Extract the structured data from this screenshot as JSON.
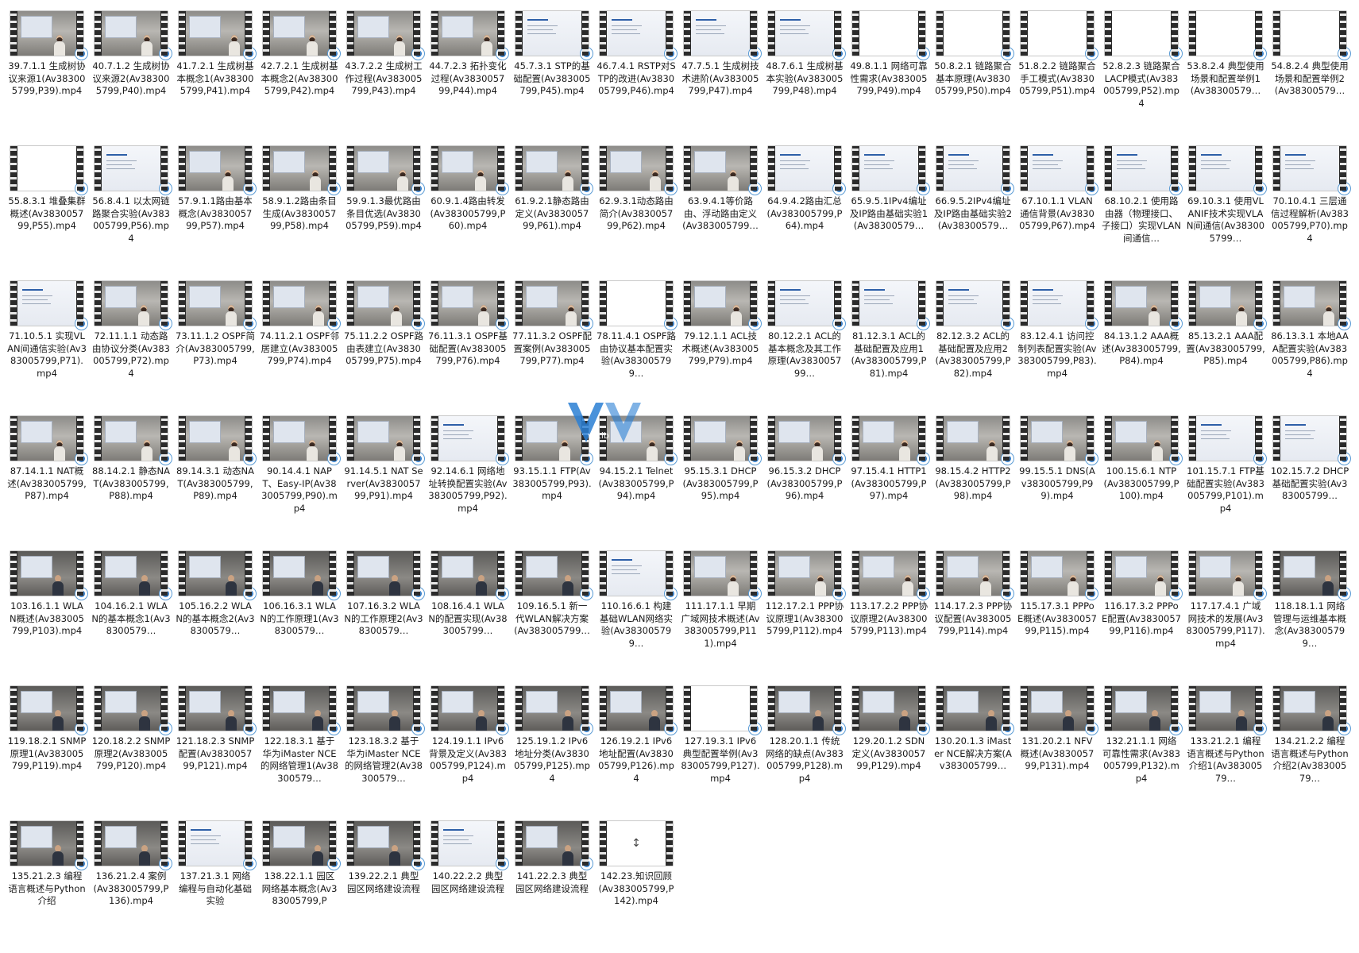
{
  "files": [
    {
      "label": "39.7.1.1 生成树协议来源1(Av383005799,P39).mp4",
      "thumb": "person"
    },
    {
      "label": "40.7.1.2 生成树协议来源2(Av383005799,P40).mp4",
      "thumb": "person"
    },
    {
      "label": "41.7.2.1 生成树基本概念1(Av383005799,P41).mp4",
      "thumb": "person"
    },
    {
      "label": "42.7.2.1 生成树基本概念2(Av383005799,P42).mp4",
      "thumb": "person"
    },
    {
      "label": "43.7.2.2 生成树工作过程(Av383005799,P43).mp4",
      "thumb": "person"
    },
    {
      "label": "44.7.2.3 拓扑变化过程(Av383005799,P44).mp4",
      "thumb": "person"
    },
    {
      "label": "45.7.3.1 STP的基础配置(Av383005799,P45).mp4",
      "thumb": "slide"
    },
    {
      "label": "46.7.4.1 RSTP对STP的改进(Av383005799,P46).mp4",
      "thumb": "slide"
    },
    {
      "label": "47.7.5.1 生成树技术进阶(Av383005799,P47).mp4",
      "thumb": "slide"
    },
    {
      "label": "48.7.6.1 生成树基本实验(Av383005799,P48).mp4",
      "thumb": "slide"
    },
    {
      "label": "49.8.1.1 网络可靠性需求(Av383005799,P49).mp4",
      "thumb": "blank"
    },
    {
      "label": "50.8.2.1 链路聚合基本原理(Av383005799,P50).mp4",
      "thumb": "blank"
    },
    {
      "label": "51.8.2.2 链路聚合手工模式(Av383005799,P51).mp4",
      "thumb": "blank"
    },
    {
      "label": "52.8.2.3 链路聚合LACP模式(Av383005799,P52).mp4",
      "thumb": "blank"
    },
    {
      "label": "53.8.2.4 典型使用场景和配置举例1(Av38300579…",
      "thumb": "blank"
    },
    {
      "label": "54.8.2.4 典型使用场景和配置举例2(Av38300579…",
      "thumb": "blank"
    },
    {
      "label": "55.8.3.1 堆叠集群概述(Av383005799,P55).mp4",
      "thumb": "blank"
    },
    {
      "label": "56.8.4.1 以太网链路聚合实验(Av383005799,P56).mp4",
      "thumb": "slide"
    },
    {
      "label": "57.9.1.1路由基本概念(Av383005799,P57).mp4",
      "thumb": "person"
    },
    {
      "label": "58.9.1.2路由条目生成(Av383005799,P58).mp4",
      "thumb": "person"
    },
    {
      "label": "59.9.1.3最优路由条目优选(Av383005799,P59).mp4",
      "thumb": "person"
    },
    {
      "label": "60.9.1.4路由转发(Av383005799,P60).mp4",
      "thumb": "person"
    },
    {
      "label": "61.9.2.1静态路由定义(Av383005799,P61).mp4",
      "thumb": "person"
    },
    {
      "label": "62.9.3.1动态路由简介(Av383005799,P62).mp4",
      "thumb": "person"
    },
    {
      "label": "63.9.4.1等价路由、浮动路由定义(Av383005799…",
      "thumb": "person"
    },
    {
      "label": "64.9.4.2路由汇总(Av383005799,P64).mp4",
      "thumb": "slide"
    },
    {
      "label": "65.9.5.1IPv4编址及IP路由基础实验1(Av38300579…",
      "thumb": "slide"
    },
    {
      "label": "66.9.5.2IPv4编址及IP路由基础实验2(Av38300579…",
      "thumb": "slide"
    },
    {
      "label": "67.10.1.1 VLAN通信背景(Av383005799,P67).mp4",
      "thumb": "slide"
    },
    {
      "label": "68.10.2.1 使用路由器（物理接口、子接口）实现VLAN间通信…",
      "thumb": "slide"
    },
    {
      "label": "69.10.3.1 使用VLANIF技术实现VLAN间通信(Av383005799…",
      "thumb": "slide"
    },
    {
      "label": "70.10.4.1 三层通信过程解析(Av383005799,P70).mp4",
      "thumb": "slide"
    },
    {
      "label": "71.10.5.1 实现VLAN间通信实验(Av383005799,P71).mp4",
      "thumb": "slide"
    },
    {
      "label": "72.11.1.1 动态路由协议分类(Av383005799,P72).mp4",
      "thumb": "person"
    },
    {
      "label": "73.11.1.2 OSPF简介(Av383005799,P73).mp4",
      "thumb": "person"
    },
    {
      "label": "74.11.2.1 OSPF邻居建立(Av383005799,P74).mp4",
      "thumb": "person"
    },
    {
      "label": "75.11.2.2 OSPF路由表建立(Av383005799,P75).mp4",
      "thumb": "person"
    },
    {
      "label": "76.11.3.1 OSPF基础配置(Av383005799,P76).mp4",
      "thumb": "person"
    },
    {
      "label": "77.11.3.2 OSPF配置案例(Av383005799,P77).mp4",
      "thumb": "person"
    },
    {
      "label": "78.11.4.1 OSPF路由协议基本配置实验(Av383005799…",
      "thumb": "blank"
    },
    {
      "label": "79.12.1.1 ACL技术概述(Av383005799,P79).mp4",
      "thumb": "person"
    },
    {
      "label": "80.12.2.1 ACL的基本概念及其工作原理(Av383005799…",
      "thumb": "slide"
    },
    {
      "label": "81.12.3.1 ACL的基础配置及应用1(Av383005799,P81).mp4",
      "thumb": "slide"
    },
    {
      "label": "82.12.3.2 ACL的基础配置及应用2(Av383005799,P82).mp4",
      "thumb": "slide"
    },
    {
      "label": "83.12.4.1 访问控制列表配置实验(Av383005799,P83).mp4",
      "thumb": "slide"
    },
    {
      "label": "84.13.1.2 AAA概述(Av383005799,P84).mp4",
      "thumb": "person"
    },
    {
      "label": "85.13.2.1 AAA配置(Av383005799,P85).mp4",
      "thumb": "person"
    },
    {
      "label": "86.13.3.1 本地AAA配置实验(Av383005799,P86).mp4",
      "thumb": "person"
    },
    {
      "label": "87.14.1.1 NAT概述(Av383005799,P87).mp4",
      "thumb": "person"
    },
    {
      "label": "88.14.2.1 静态NAT(Av383005799,P88).mp4",
      "thumb": "person"
    },
    {
      "label": "89.14.3.1 动态NAT(Av383005799,P89).mp4",
      "thumb": "person"
    },
    {
      "label": "90.14.4.1 NAPT、Easy-IP(Av383005799,P90).mp4",
      "thumb": "person"
    },
    {
      "label": "91.14.5.1 NAT Server(Av383005799,P91).mp4",
      "thumb": "person"
    },
    {
      "label": "92.14.6.1 网络地址转换配置实验(Av383005799,P92).mp4",
      "thumb": "slide"
    },
    {
      "label": "93.15.1.1 FTP(Av383005799,P93).mp4",
      "thumb": "person"
    },
    {
      "label": "94.15.2.1 Telnet(Av383005799,P94).mp4",
      "thumb": "person"
    },
    {
      "label": "95.15.3.1 DHCP(Av383005799,P95).mp4",
      "thumb": "person"
    },
    {
      "label": "96.15.3.2 DHCP(Av383005799,P96).mp4",
      "thumb": "person"
    },
    {
      "label": "97.15.4.1 HTTP1(Av383005799,P97).mp4",
      "thumb": "person"
    },
    {
      "label": "98.15.4.2 HTTP2(Av383005799,P98).mp4",
      "thumb": "person"
    },
    {
      "label": "99.15.5.1 DNS(Av383005799,P99).mp4",
      "thumb": "person"
    },
    {
      "label": "100.15.6.1 NTP(Av383005799,P100).mp4",
      "thumb": "person"
    },
    {
      "label": "101.15.7.1 FTP基础配置实验(Av383005799,P101).mp4",
      "thumb": "slide"
    },
    {
      "label": "102.15.7.2 DHCP基础配置实验(Av383005799…",
      "thumb": "slide"
    },
    {
      "label": "103.16.1.1 WLAN概述(Av383005799,P103).mp4",
      "thumb": "dark"
    },
    {
      "label": "104.16.2.1 WLAN的基本概念1(Av38300579…",
      "thumb": "dark"
    },
    {
      "label": "105.16.2.2 WLAN的基本概念2(Av38300579…",
      "thumb": "dark"
    },
    {
      "label": "106.16.3.1 WLAN的工作原理1(Av38300579…",
      "thumb": "dark"
    },
    {
      "label": "107.16.3.2 WLAN的工作原理2(Av38300579…",
      "thumb": "dark"
    },
    {
      "label": "108.16.4.1 WLAN的配置实现(Av383005799…",
      "thumb": "dark"
    },
    {
      "label": "109.16.5.1 新一代WLAN解决方案(Av383005799…",
      "thumb": "dark"
    },
    {
      "label": "110.16.6.1 构建基础WLAN网络实验(Av383005799…",
      "thumb": "slide"
    },
    {
      "label": "111.17.1.1 早期广域网技术概述(Av383005799,P111).mp4",
      "thumb": "person"
    },
    {
      "label": "112.17.2.1 PPP协议原理1(Av383005799,P112).mp4",
      "thumb": "person"
    },
    {
      "label": "113.17.2.2 PPP协议原理2(Av383005799,P113).mp4",
      "thumb": "person"
    },
    {
      "label": "114.17.2.3 PPP协议配置(Av383005799,P114).mp4",
      "thumb": "person"
    },
    {
      "label": "115.17.3.1 PPPoE概述(Av383005799,P115).mp4",
      "thumb": "person"
    },
    {
      "label": "116.17.3.2 PPPoE配置(Av383005799,P116).mp4",
      "thumb": "person"
    },
    {
      "label": "117.17.4.1 广域网技术的发展(Av383005799,P117).mp4",
      "thumb": "person"
    },
    {
      "label": "118.18.1.1 网络管理与运维基本概念(Av383005799…",
      "thumb": "dark"
    },
    {
      "label": "119.18.2.1 SNMP原理1(Av383005799,P119).mp4",
      "thumb": "dark"
    },
    {
      "label": "120.18.2.2 SNMP原理2(Av383005799,P120).mp4",
      "thumb": "dark"
    },
    {
      "label": "121.18.2.3 SNMP配置(Av383005799,P121).mp4",
      "thumb": "dark"
    },
    {
      "label": "122.18.3.1 基于华为iMaster NCE的网络管理1(Av38300579…",
      "thumb": "dark"
    },
    {
      "label": "123.18.3.2 基于华为iMaster NCE的网络管理2(Av38300579…",
      "thumb": "dark"
    },
    {
      "label": "124.19.1.1 IPv6背景及定义(Av383005799,P124).mp4",
      "thumb": "dark"
    },
    {
      "label": "125.19.1.2 IPv6地址分类(Av383005799,P125).mp4",
      "thumb": "dark"
    },
    {
      "label": "126.19.2.1 IPv6地址配置(Av383005799,P126).mp4",
      "thumb": "dark"
    },
    {
      "label": "127.19.3.1 IPv6典型配置举例(Av383005799,P127).mp4",
      "thumb": "blank"
    },
    {
      "label": "128.20.1.1 传统网络的缺点(Av383005799,P128).mp4",
      "thumb": "dark"
    },
    {
      "label": "129.20.1.2 SDN定义(Av383005799,P129).mp4",
      "thumb": "dark"
    },
    {
      "label": "130.20.1.3 iMaster NCE解决方案(Av383005799…",
      "thumb": "dark"
    },
    {
      "label": "131.20.2.1 NFV概述(Av383005799,P131).mp4",
      "thumb": "dark"
    },
    {
      "label": "132.21.1.1 网络可靠性需求(Av383005799,P132).mp4",
      "thumb": "dark"
    },
    {
      "label": "133.21.2.1 编程语言概述与Python介绍1(Av38300579…",
      "thumb": "dark"
    },
    {
      "label": "134.21.2.2 编程语言概述与Python介绍2(Av38300579…",
      "thumb": "dark"
    },
    {
      "label": "135.21.2.3 编程语言概述与Python介绍",
      "thumb": "dark"
    },
    {
      "label": "136.21.2.4 案例(Av383005799,P136).mp4",
      "thumb": "dark"
    },
    {
      "label": "137.21.3.1 网络编程与自动化基础实验",
      "thumb": "slide"
    },
    {
      "label": "138.22.1.1 园区网络基本概念(Av383005799,P",
      "thumb": "dark"
    },
    {
      "label": "139.22.2.1 典型园区网络建设流程",
      "thumb": "dark"
    },
    {
      "label": "140.22.2.2 典型园区网络建设流程",
      "thumb": "slide"
    },
    {
      "label": "141.22.2.3 典型园区网络建设流程",
      "thumb": "dark"
    },
    {
      "label": "142.23.知识回顾(Av383005799,P142).mp4",
      "thumb": "loading"
    }
  ],
  "watermark_text": "vctib"
}
